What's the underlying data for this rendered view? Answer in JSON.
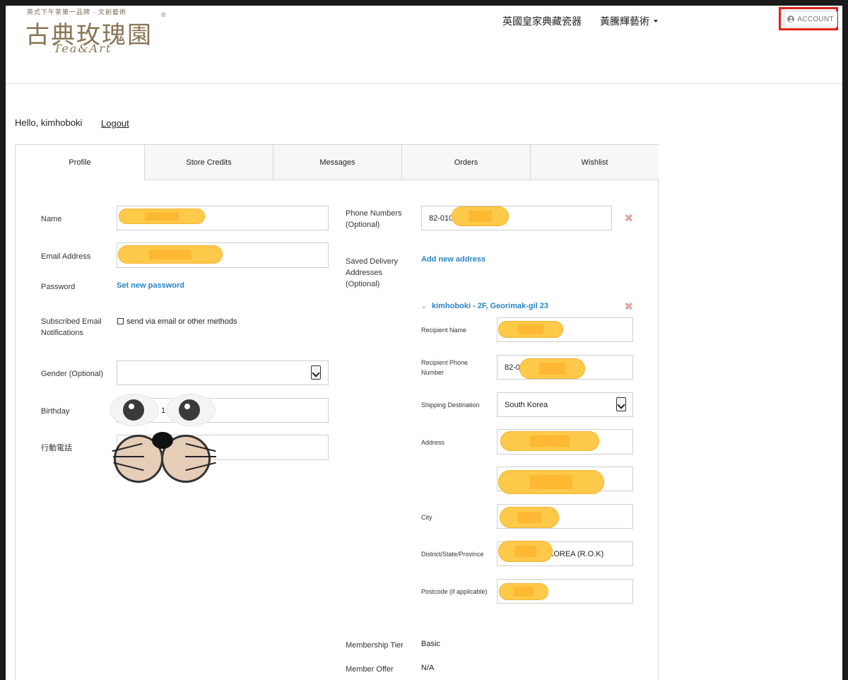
{
  "header": {
    "logo": {
      "tagline": "英式下午茶第一品牌 · 文創藝術",
      "chinese": "古典玫瑰園",
      "english": "Tea&Art",
      "reg": "®"
    },
    "nav": [
      {
        "label": "英國皇家典藏瓷器",
        "dropdown": false
      },
      {
        "label": "黃騰輝藝術",
        "dropdown": true
      }
    ],
    "account_label": "ACCOUNT"
  },
  "greeting": {
    "hello": "Hello, kimhoboki",
    "logout": "Logout"
  },
  "tabs": [
    "Profile",
    "Store Credits",
    "Messages",
    "Orders",
    "Wishlist"
  ],
  "profile": {
    "name_label": "Name",
    "email_label": "Email Address",
    "password_label": "Password",
    "password_link": "Set new password",
    "subscribed_label_1": "Subscribed Email",
    "subscribed_label_2": "Notifications",
    "subscribed_option": "send via email or other methods",
    "gender_label": "Gender (Optional)",
    "birthday_label": "Birthday",
    "birthday_value": "1",
    "mobile_label": "行動電話",
    "phone_label_1": "Phone Numbers",
    "phone_label_2": "(Optional)",
    "phone_value": "82-010",
    "saved_label_1": "Saved Delivery",
    "saved_label_2": "Addresses",
    "saved_label_3": "(Optional)",
    "add_address": "Add new address",
    "address_entry": "kimhoboki - 2F, Georimak-gil 23",
    "recipient_name_label": "Recipient Name",
    "recipient_phone_label_1": "Recipient Phone",
    "recipient_phone_label_2": "Number",
    "recipient_phone_value": "82-0",
    "shipping_label": "Shipping Destination",
    "shipping_value": "South Korea",
    "address_label": "Address",
    "city_label": "City",
    "district_label": "District/State/Province",
    "district_value": "KOREA (R.O.K)",
    "postcode_label": "Postcode (if applicable)",
    "membership_label": "Membership Tier",
    "membership_value": "Basic",
    "offer_label": "Member Offer",
    "offer_value": "N/A"
  },
  "colors": {
    "accent_link": "#2a84c6",
    "highlight_box": "#e0211b",
    "logo_gold": "#8a7454"
  }
}
